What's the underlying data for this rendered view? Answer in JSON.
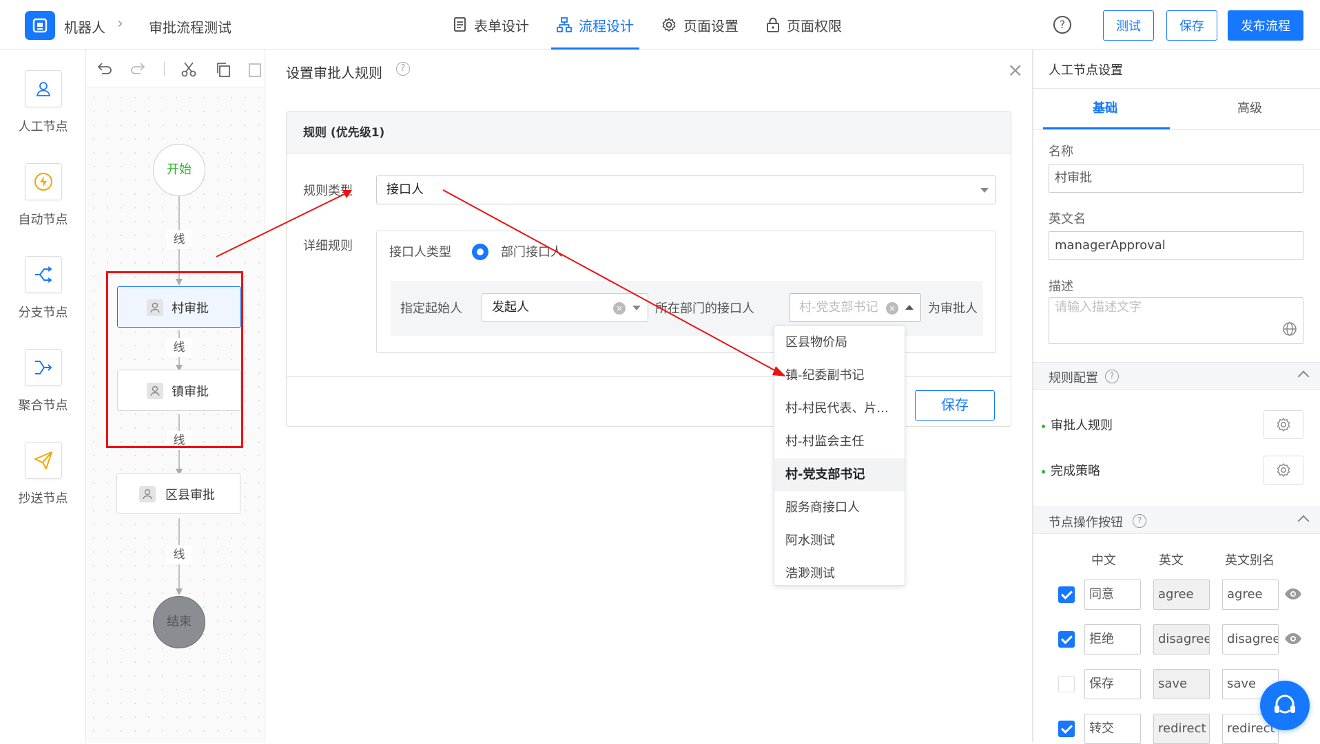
{
  "header": {
    "app_name": "机器人",
    "process_name": "审批流程测试",
    "tabs": [
      {
        "label": "表单设计",
        "icon": "document-icon"
      },
      {
        "label": "流程设计",
        "icon": "flow-icon"
      },
      {
        "label": "页面设置",
        "icon": "gear-icon"
      },
      {
        "label": "页面权限",
        "icon": "lock-icon"
      }
    ],
    "active_tab": "流程设计",
    "help": "?",
    "buttons": {
      "test": "测试",
      "save": "保存",
      "publish": "发布流程"
    },
    "accent": "#1677ff"
  },
  "palette": [
    {
      "label": "人工节点",
      "icon": "user-icon"
    },
    {
      "label": "自动节点",
      "icon": "lightning-icon"
    },
    {
      "label": "分支节点",
      "icon": "branch-icon"
    },
    {
      "label": "聚合节点",
      "icon": "merge-icon"
    },
    {
      "label": "抄送节点",
      "icon": "send-icon"
    }
  ],
  "flow": {
    "start": "开始",
    "end": "结束",
    "line_label": "线",
    "nodes": [
      "村审批",
      "镇审批",
      "区县审批"
    ]
  },
  "dialog": {
    "title": "设置审批人规则",
    "help": "?",
    "close": "×",
    "rule_header": "规则 (优先级1)",
    "rule_type_label": "规则类型",
    "rule_type_value": "接口人",
    "detail_label": "详细规则",
    "contact_type_label": "接口人类型",
    "contact_type_option": "部门接口人",
    "start_label": "指定起始人",
    "start_value": "发起人",
    "dept_text": "所在部门的接口人",
    "contact_placeholder": "村-党支部书记",
    "as_approver": "为审批人",
    "save": "保存",
    "options": [
      "区县物价局",
      "镇-纪委副书记",
      "村-村民代表、片...",
      "村-村监会主任",
      "村-党支部书记",
      "服务商接口人",
      "阿水测试",
      "浩渺测试"
    ],
    "selected_option": "村-党支部书记"
  },
  "right_panel": {
    "title": "人工节点设置",
    "tabs": [
      "基础",
      "高级"
    ],
    "active_tab": "基础",
    "name_label": "名称",
    "name_value": "村审批",
    "en_label": "英文名",
    "en_value": "managerApproval",
    "desc_label": "描述",
    "desc_placeholder": "请输入描述文字",
    "rule_section": "规则配置",
    "rule_items": [
      "审批人规则",
      "完成策略"
    ],
    "ops_section": "节点操作按钮",
    "ops_headers": [
      "中文",
      "英文",
      "英文别名"
    ],
    "ops": [
      {
        "checked": true,
        "cn": "同意",
        "en": "agree",
        "alias": "agree"
      },
      {
        "checked": true,
        "cn": "拒绝",
        "en": "disagree",
        "alias": "disagree"
      },
      {
        "checked": false,
        "cn": "保存",
        "en": "save",
        "alias": "save"
      },
      {
        "checked": true,
        "cn": "转交",
        "en": "redirect",
        "alias": "redirect"
      }
    ]
  },
  "annotation_color": "#ee1111"
}
